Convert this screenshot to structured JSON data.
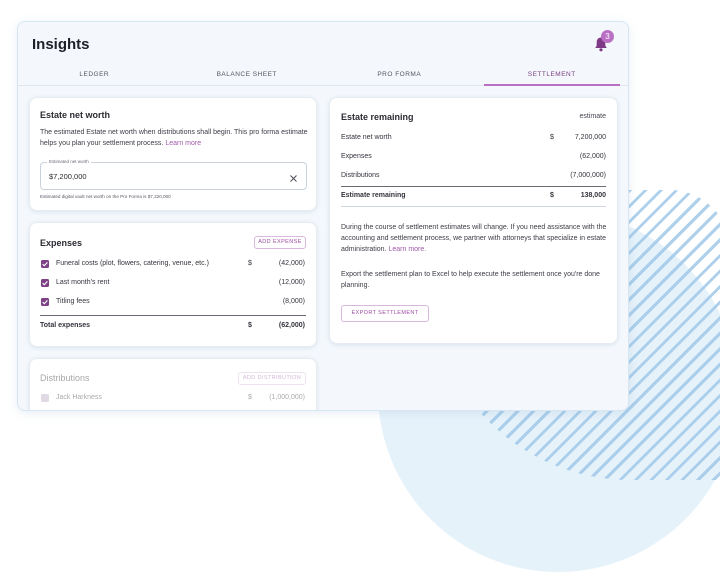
{
  "app": {
    "title": "Insights",
    "notification_count": "3"
  },
  "tabs": [
    {
      "label": "LEDGER",
      "active": false
    },
    {
      "label": "BALANCE SHEET",
      "active": false
    },
    {
      "label": "PRO FORMA",
      "active": false
    },
    {
      "label": "SETTLEMENT",
      "active": true
    }
  ],
  "net_worth": {
    "title": "Estate net worth",
    "desc": "The estimated Estate net worth when distributions shall begin. This pro forma estimate helps you plan your settlement process.",
    "learn_more": "Learn more",
    "input_label": "Estimated net worth",
    "input_value": "$7,200,000",
    "hint": "Estimated digital vault net worth on the Pro Forma is $7,320,000"
  },
  "expenses": {
    "title": "Expenses",
    "add_label": "ADD EXPENSE",
    "items": [
      {
        "label": "Funeral costs (plot, flowers, catering, venue, etc.)",
        "currency": "$",
        "amount": "(42,000)"
      },
      {
        "label": "Last month's rent",
        "currency": "",
        "amount": "(12,000)"
      },
      {
        "label": "Titling fees",
        "currency": "",
        "amount": "(8,000)"
      }
    ],
    "total_label": "Total expenses",
    "total_currency": "$",
    "total_amount": "(62,000)"
  },
  "distributions": {
    "title": "Distributions",
    "add_label": "ADD DISTRIBUTION",
    "items": [
      {
        "label": "Jack Harkness",
        "currency": "$",
        "amount": "(1,000,000)"
      }
    ]
  },
  "remaining": {
    "title": "Estate remaining",
    "tag": "estimate",
    "rows": [
      {
        "label": "Estate net worth",
        "currency": "$",
        "amount": "7,200,000"
      },
      {
        "label": "Expenses",
        "currency": "",
        "amount": "(62,000)"
      },
      {
        "label": "Distributions",
        "currency": "",
        "amount": "(7,000,000)"
      }
    ],
    "total_label": "Estimate remaining",
    "total_currency": "$",
    "total_amount": "138,000",
    "para1": "During the course of settlement estimates will change. If you need assistance with the accounting and settlement process, we partner with attorneys that specialize in estate administration.",
    "para1_link": "Learn more.",
    "para2": "Export the settlement plan to Excel to help execute the settlement once you're done planning.",
    "export_label": "EXPORT SETTLEMENT"
  },
  "colors": {
    "accent": "#b86fc4",
    "checkbox": "#7e4186",
    "background_circle": "#e6f2fa"
  }
}
